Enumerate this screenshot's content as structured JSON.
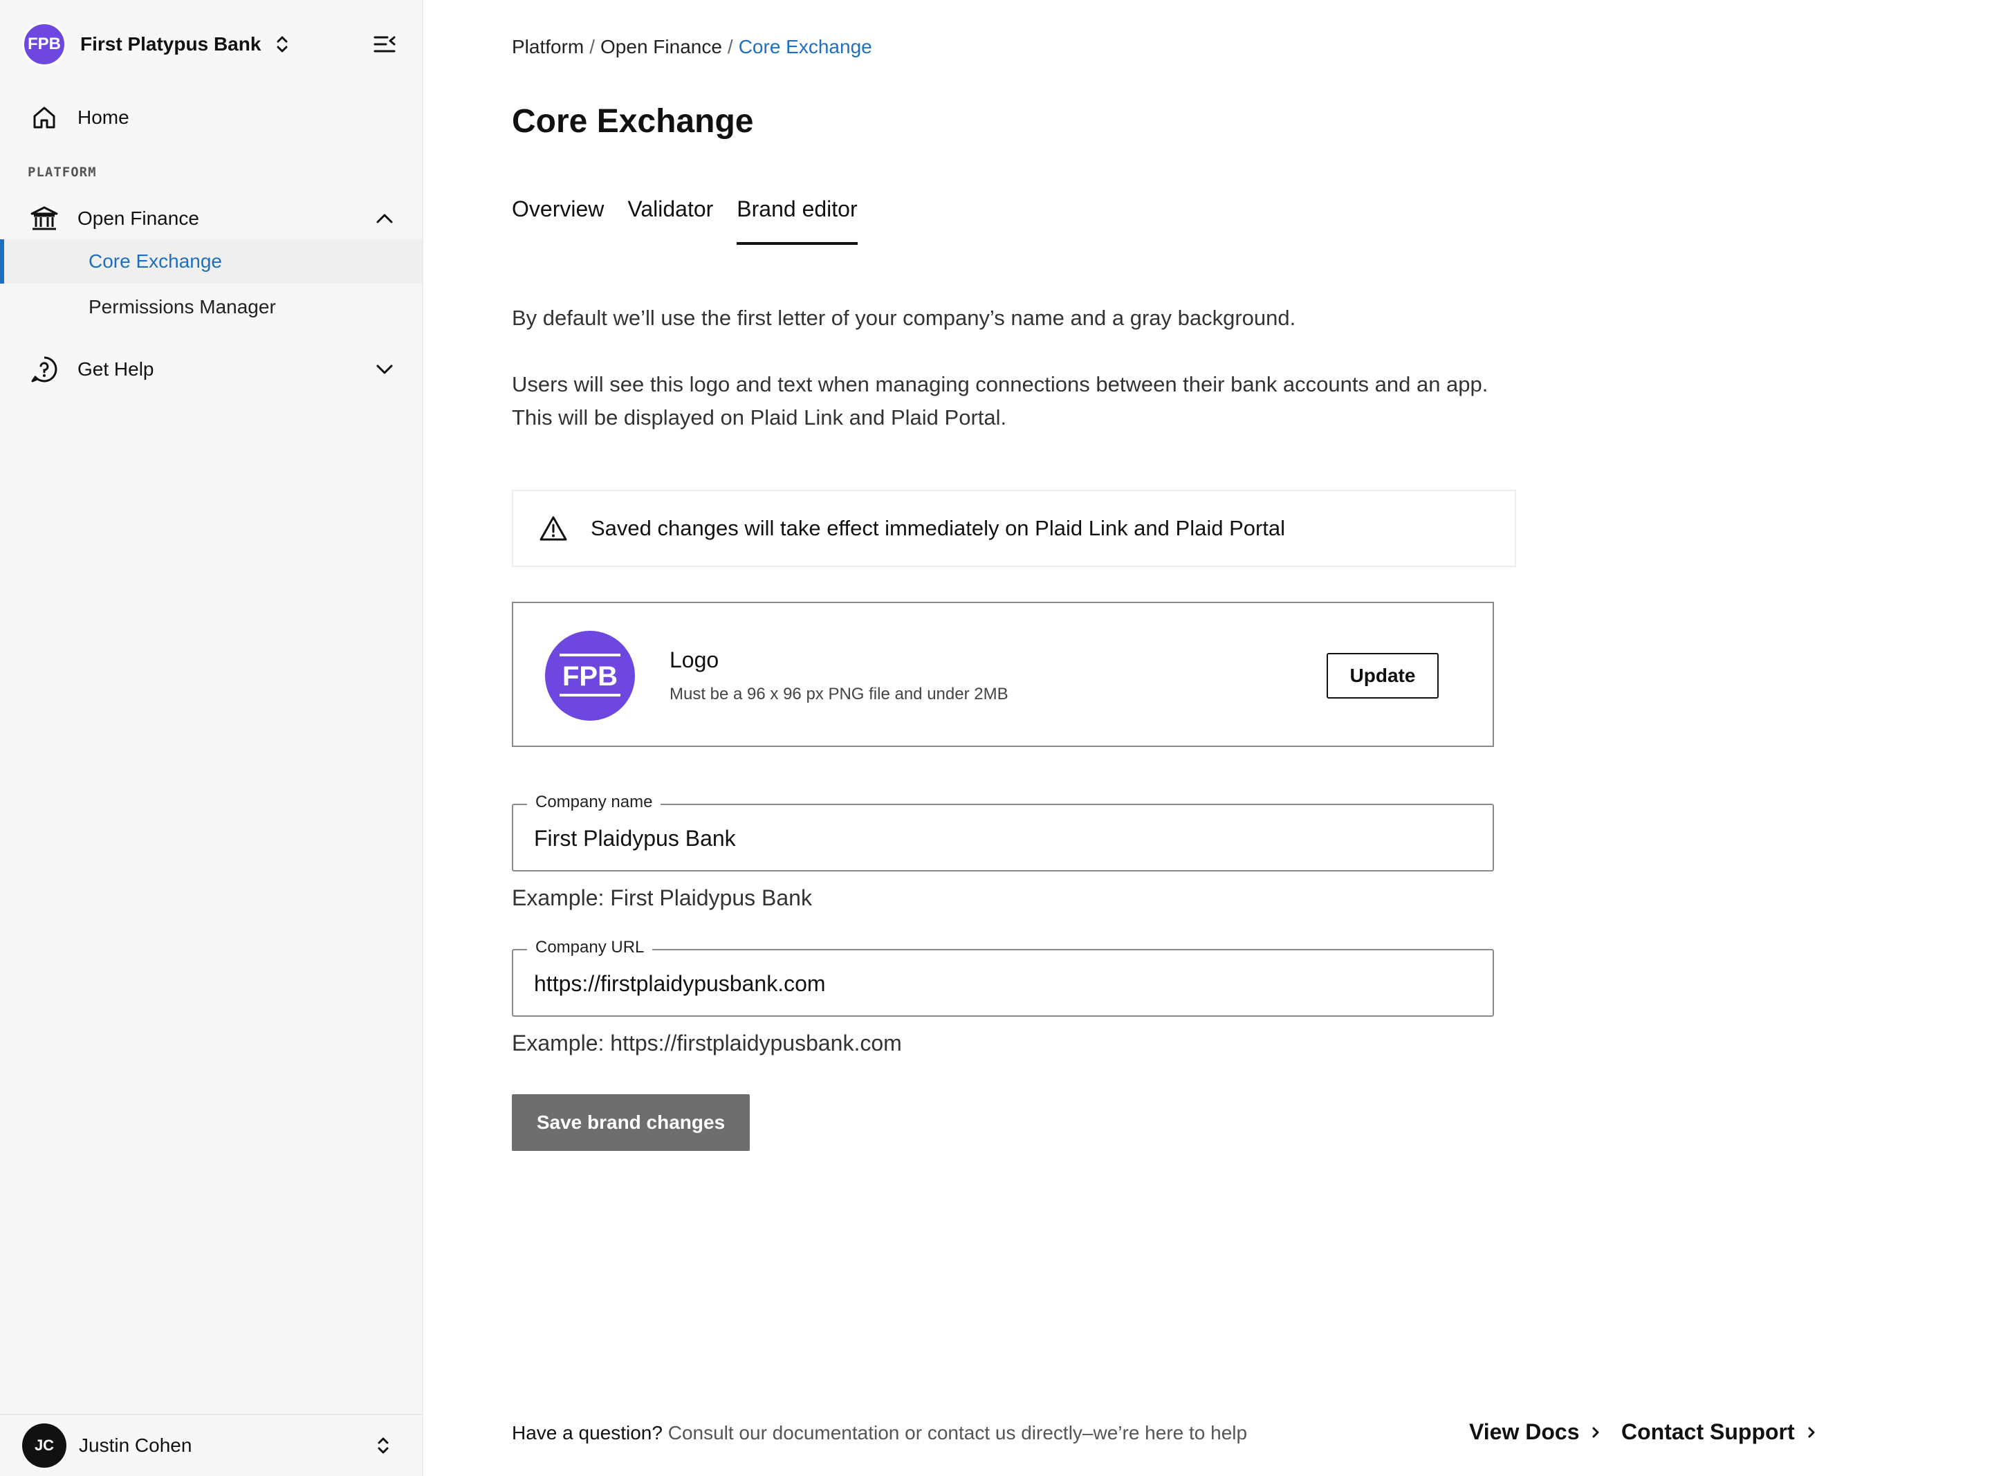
{
  "org": {
    "initials": "FPB",
    "name": "First Platypus Bank"
  },
  "nav": {
    "home": "Home",
    "section": "PLATFORM",
    "open_finance": "Open Finance",
    "sub_items": [
      "Core Exchange",
      "Permissions Manager"
    ],
    "get_help": "Get Help"
  },
  "user": {
    "initials": "JC",
    "name": "Justin Cohen"
  },
  "breadcrumb": {
    "items": [
      "Platform",
      "Open Finance",
      "Core Exchange"
    ],
    "separator": "/"
  },
  "page": {
    "title": "Core Exchange"
  },
  "tabs": [
    "Overview",
    "Validator",
    "Brand editor"
  ],
  "active_tab": "Brand editor",
  "intro": {
    "p1": "By default we’ll use the first letter of your company’s name and a gray background.",
    "p2": "Users will see this logo and text when managing connections between their bank accounts and an app. This will be displayed on Plaid Link and Plaid Portal."
  },
  "notice": {
    "text": "Saved changes will take effect immediately on Plaid Link and Plaid Portal"
  },
  "logo_card": {
    "initials": "FPB",
    "title": "Logo",
    "help": "Must be a 96 x 96 px PNG file and under 2MB",
    "update_label": "Update"
  },
  "form": {
    "company_name": {
      "label": "Company name",
      "value": "First Plaidypus Bank",
      "example": "Example: First Plaidypus Bank"
    },
    "company_url": {
      "label": "Company URL",
      "value": "https://firstplaidypusbank.com",
      "example": "Example: https://firstplaidypusbank.com"
    },
    "save_label": "Save brand changes"
  },
  "footer": {
    "question": "Have a question?",
    "text": " Consult our documentation or contact us directly–we’re here to help",
    "docs": "View Docs",
    "support": "Contact Support"
  },
  "colors": {
    "brand": "#6e46e0",
    "link": "#1e6fc0",
    "save_button": "#6e6e6e"
  }
}
